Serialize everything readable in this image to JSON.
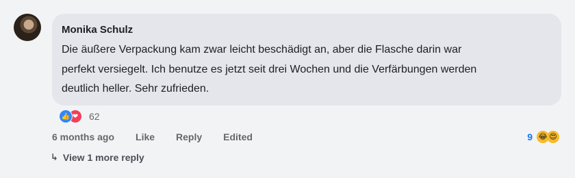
{
  "comment": {
    "author": "Monika Schulz",
    "text": "Die äußere Verpackung kam zwar leicht beschädigt an, aber die Flasche darin war\nperfekt versiegelt. Ich benutze es jetzt seit drei Wochen und die Verfärbungen werden\ndeutlich heller. Sehr zufrieden.",
    "avatar_icon": "user-avatar-photo"
  },
  "reactions": {
    "icons": [
      "like-icon",
      "love-icon"
    ],
    "count": "62",
    "colors": {
      "like": "#2d88ff",
      "love": "#f33e58"
    }
  },
  "actions": {
    "timestamp": "6 months ago",
    "like_label": "Like",
    "reply_label": "Reply",
    "edited_label": "Edited"
  },
  "reply_reactions": {
    "count": "9",
    "icons": [
      "laughing-emoji-icon",
      "heart-eyes-emoji-icon"
    ]
  },
  "replies": {
    "label": "View 1 more reply",
    "icon": "reply-arrow-icon"
  }
}
